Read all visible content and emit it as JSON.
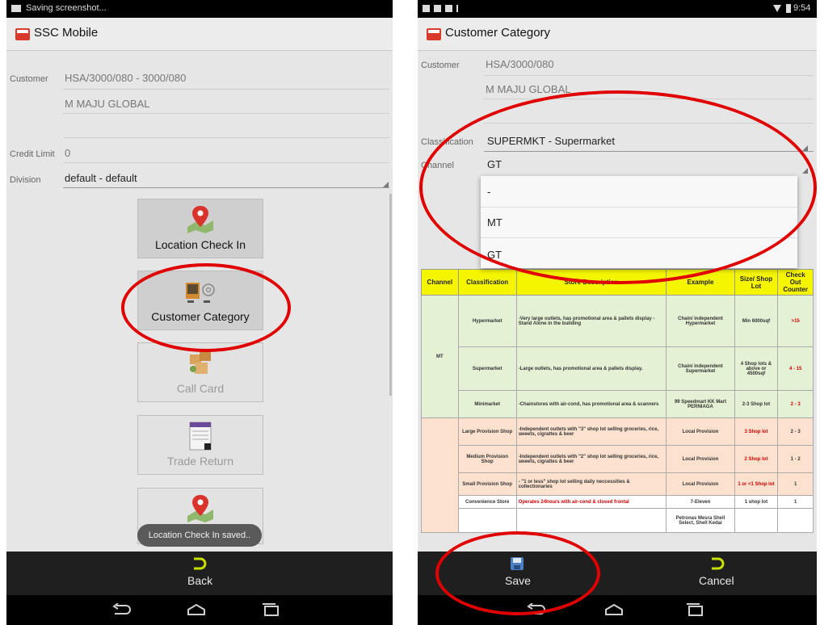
{
  "left": {
    "status_text": "Saving screenshot...",
    "app_title": "SSC Mobile",
    "customer_label": "Customer",
    "customer_code": "HSA/3000/080 - 3000/080",
    "customer_name": "M MAJU GLOBAL",
    "credit_limit_label": "Credit Limit",
    "credit_limit_value": "0",
    "division_label": "Division",
    "division_value": "default - default",
    "buttons": [
      {
        "label": "Location Check In",
        "icon": "map-pin-icon",
        "enabled": true
      },
      {
        "label": "Customer Category",
        "icon": "contact-card-icon",
        "enabled": true
      },
      {
        "label": "Call Card",
        "icon": "boxes-icon",
        "enabled": false
      },
      {
        "label": "Trade Return",
        "icon": "return-form-icon",
        "enabled": false
      },
      {
        "label": "",
        "icon": "map-pin-icon",
        "enabled": false
      }
    ],
    "toast": "Location Check In saved..",
    "back_label": "Back"
  },
  "right": {
    "status_time": "9:54",
    "app_title": "Customer Category",
    "customer_label": "Customer",
    "customer_code": "HSA/3000/080",
    "customer_name": "M MAJU GLOBAL",
    "classification_label": "Classification",
    "classification_value": "SUPERMKT - Supermarket",
    "channel_label": "Channel",
    "channel_value": "GT",
    "dropdown_options": [
      "-",
      "MT",
      "GT"
    ],
    "save_label": "Save",
    "cancel_label": "Cancel",
    "table": {
      "headers": [
        "Channel",
        "Classification",
        "Store Description",
        "Example",
        "Size/ Shop Lot",
        "Check Out Counter"
      ],
      "rows": [
        {
          "channel": "MT",
          "classification": "Hypermarket",
          "description": "-Very large outlets, has promotional area & pallets display -Stand Alone in the building",
          "example": "Chain/ independent Hypermarket",
          "size": "Min 6000sqf",
          "counter": ">15"
        },
        {
          "channel": "",
          "classification": "Supermarket",
          "description": "-Large outlets, has promotional area & pallets display.",
          "example": "Chain/ independent Supermarket",
          "size": "4 Shop lots & above or 4500sqf",
          "counter": "4 - 15"
        },
        {
          "channel": "",
          "classification": "Minimarket",
          "description": "-Chainstores with air-cond, has promotional area & scanners",
          "example": "99 Speedmart KK Mart PERNIAGA",
          "size": "2-3 Shop lot",
          "counter": "2 - 3"
        },
        {
          "channel": "",
          "classification": "Large Provision Shop",
          "description": "-Independent outlets with \"3\" shop lot selling groceries, rice, sweets, cigrattes & beer",
          "example": "Local Provision",
          "size": "3 Shop lot",
          "counter": "2 - 3"
        },
        {
          "channel": "",
          "classification": "Medium Provision Shop",
          "description": "-Independent outlets with \"2\" shop lot selling groceries, rice, sweets, cigrattes & beer",
          "example": "Local Provision",
          "size": "2 Shop lot",
          "counter": "1 - 2"
        },
        {
          "channel": "",
          "classification": "Small Provision Shop",
          "description": "- \"1 or less\" shop lot selling daily neccessities & collectionaries",
          "example": "Local Provision",
          "size": "1 or <1 Shop lot",
          "counter": "1"
        },
        {
          "channel": "",
          "classification": "Convenience Store",
          "description": "Operates 24hours with air-cond & closed frontal",
          "example": "7-Eleven",
          "size": "1 shop lot",
          "counter": "1"
        },
        {
          "channel": "",
          "classification": "",
          "description": "",
          "example": "Petronas Mesra Shell Select, Shell Kedai",
          "size": "",
          "counter": ""
        }
      ]
    }
  },
  "colors": {
    "annotation": "#e00000",
    "header_yellow": "#f5f500",
    "mt_green": "#e4f1d4",
    "gt_orange": "#fce1cf"
  }
}
